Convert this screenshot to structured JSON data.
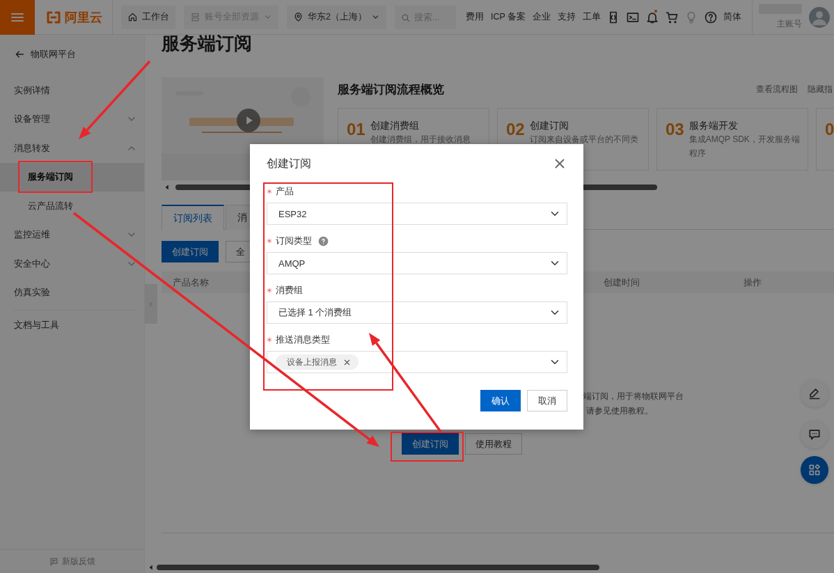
{
  "header": {
    "brand": "阿里云",
    "nav": [
      {
        "label": "工作台",
        "disabled": false,
        "dropdown": false
      },
      {
        "label": "账号全部资源",
        "disabled": true,
        "dropdown": true
      },
      {
        "label": "华东2（上海）",
        "disabled": false,
        "dropdown": true
      }
    ],
    "search": {
      "placeholder": "搜索..."
    },
    "links": [
      "费用",
      "ICP 备案",
      "企业",
      "支持",
      "工单"
    ],
    "tools": [
      {
        "disabled": false,
        "dot": false
      },
      {
        "disabled": false,
        "dot": false
      },
      {
        "disabled": false,
        "dot": true
      },
      {
        "disabled": false,
        "dot": false
      },
      {
        "disabled": true,
        "dot": false
      },
      {
        "disabled": false,
        "dot": false
      }
    ],
    "language": "简体",
    "account": {
      "role": "主账号"
    }
  },
  "sidebar": {
    "back": "物联网平台",
    "items": [
      {
        "label": "实例详情",
        "kind": "link",
        "selected": false
      },
      {
        "label": "设备管理",
        "kind": "group",
        "expanded": false,
        "selected": false
      },
      {
        "label": "消息转发",
        "kind": "group",
        "expanded": true,
        "selected": false,
        "children": [
          {
            "label": "服务端订阅",
            "kind": "link",
            "selected": true
          },
          {
            "label": "云产品流转",
            "kind": "link",
            "selected": false
          }
        ]
      },
      {
        "label": "监控运维",
        "kind": "group",
        "expanded": false,
        "selected": false
      },
      {
        "label": "安全中心",
        "kind": "group",
        "expanded": false,
        "selected": false
      },
      {
        "label": "仿真实验",
        "kind": "link",
        "selected": false
      }
    ],
    "docs": "文档与工具",
    "feedback": "新版反馈"
  },
  "main": {
    "title": "服务端订阅",
    "guide": {
      "heading": "服务端订阅流程概览",
      "actions": [
        "查看流程图",
        "隐藏指"
      ],
      "steps": [
        {
          "num": "01",
          "title": "创建消费组",
          "desc": "创建消费组，用于接收消息"
        },
        {
          "num": "02",
          "title": "创建订阅",
          "desc": "订阅来自设备或平台的不同类"
        },
        {
          "num": "03",
          "title": "服务端开发",
          "desc": "集成AMQP SDK，开发服务端程序"
        },
        {
          "num": "0"
        }
      ]
    },
    "tabs": [
      {
        "label": "订阅列表",
        "selected": true
      },
      {
        "label": "消",
        "selected": false
      }
    ],
    "toolbar": [
      {
        "label": "创建订阅",
        "kind": "primary"
      },
      {
        "label": "全",
        "kind": "default"
      }
    ],
    "table": {
      "columns": [
        "产品名称",
        "创建时间",
        "操作"
      ]
    },
    "empty": {
      "lines": [
        "端订阅，用于将物联网平台",
        "请参见使用教程。"
      ],
      "buttons": [
        {
          "label": "创建订阅",
          "kind": "primary"
        },
        {
          "label": "使用教程",
          "kind": "default"
        }
      ]
    }
  },
  "dialog": {
    "title": "创建订阅",
    "fields": [
      {
        "label": "产品",
        "required": true,
        "help": false,
        "value": "ESP32"
      },
      {
        "label": "订阅类型",
        "required": true,
        "help": true,
        "value": "AMQP"
      },
      {
        "label": "消费组",
        "required": true,
        "help": false,
        "value": "已选择 1 个消费组"
      },
      {
        "label": "推送消息类型",
        "required": true,
        "help": false,
        "tags": [
          "设备上报消息"
        ]
      }
    ],
    "buttons": [
      {
        "label": "确认",
        "kind": "primary"
      },
      {
        "label": "取消",
        "kind": "default"
      }
    ]
  }
}
